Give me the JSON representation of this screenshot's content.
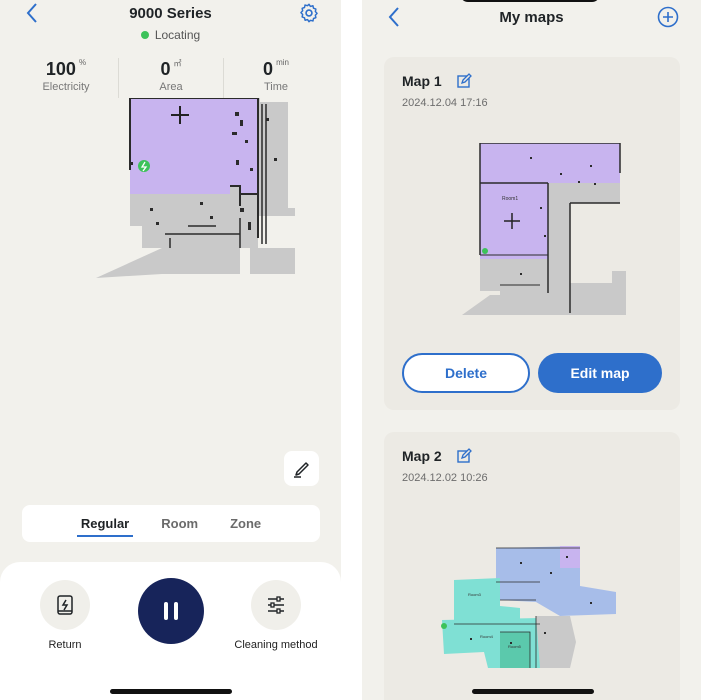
{
  "left_screen": {
    "title": "9000 Series",
    "status": "Locating",
    "stats": [
      {
        "value": "100",
        "unit": "%",
        "label": "Electricity"
      },
      {
        "value": "0",
        "unit": "㎡",
        "label": "Area"
      },
      {
        "value": "0",
        "unit": "min",
        "label": "Time"
      }
    ],
    "modes": [
      "Regular",
      "Room",
      "Zone"
    ],
    "active_mode": "Regular",
    "actions": {
      "return_label": "Return",
      "cleaning_method_label": "Cleaning method"
    }
  },
  "right_screen": {
    "title": "My maps",
    "maps": [
      {
        "name": "Map 1",
        "date": "2024.12.04 17:16",
        "room_label": "Room1"
      },
      {
        "name": "Map 2",
        "date": "2024.12.02 10:26",
        "room_labels": [
          "Room3",
          "Room4",
          "Room5"
        ]
      }
    ],
    "delete_label": "Delete",
    "edit_label": "Edit map"
  },
  "colors": {
    "accent": "#2e6fcb",
    "background": "#f2f1ec",
    "pause_button": "#17245a",
    "room_purple": "#c8b4ef",
    "floor_gray": "#cbcbcb",
    "charger_green": "#3dc25a"
  },
  "icons": [
    "back-chevron-icon",
    "gear-icon",
    "add-circle-icon",
    "edit-icon",
    "dock-icon",
    "pause-icon",
    "sliders-icon",
    "pen-icon"
  ]
}
